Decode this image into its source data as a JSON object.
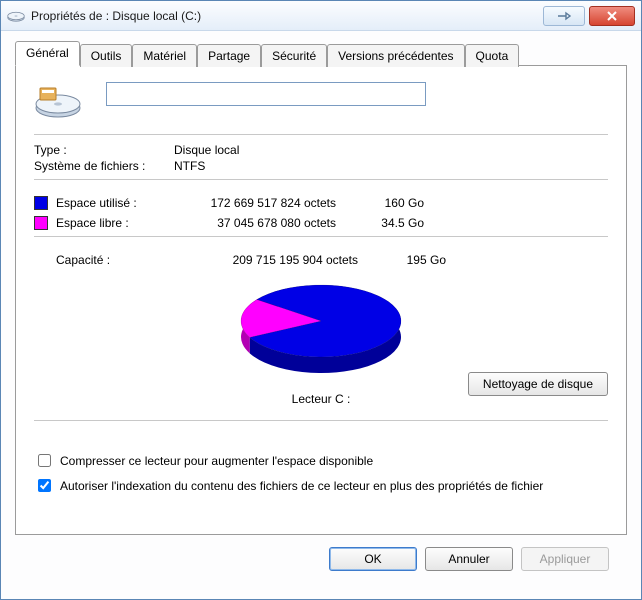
{
  "window": {
    "title": "Propriétés de : Disque local (C:)"
  },
  "tabs": {
    "general": "Général",
    "tools": "Outils",
    "hardware": "Matériel",
    "sharing": "Partage",
    "security": "Sécurité",
    "previous": "Versions précédentes",
    "quota": "Quota"
  },
  "label_value": "",
  "info": {
    "type_label": "Type :",
    "type_value": "Disque local",
    "fs_label": "Système de fichiers :",
    "fs_value": "NTFS"
  },
  "space": {
    "used_label": "Espace utilisé :",
    "used_bytes": "172 669 517 824 octets",
    "used_size": "160 Go",
    "free_label": "Espace libre :",
    "free_bytes": "37 045 678 080 octets",
    "free_size": "34.5 Go"
  },
  "capacity": {
    "label": "Capacité :",
    "bytes": "209 715 195 904 octets",
    "size": "195 Go"
  },
  "drive_label": "Lecteur C :",
  "cleanup_label": "Nettoyage de disque",
  "checks": {
    "compress": "Compresser ce lecteur pour augmenter l'espace disponible",
    "compress_checked": false,
    "index": "Autoriser l'indexation du contenu des fichiers de ce lecteur en plus des propriétés de fichier",
    "index_checked": true
  },
  "buttons": {
    "ok": "OK",
    "cancel": "Annuler",
    "apply": "Appliquer"
  },
  "chart_data": {
    "type": "pie",
    "title": "Lecteur C :",
    "series": [
      {
        "name": "Espace utilisé",
        "value": 172669517824,
        "color": "#0000e6"
      },
      {
        "name": "Espace libre",
        "value": 37045678080,
        "color": "#ff00ff"
      }
    ]
  }
}
